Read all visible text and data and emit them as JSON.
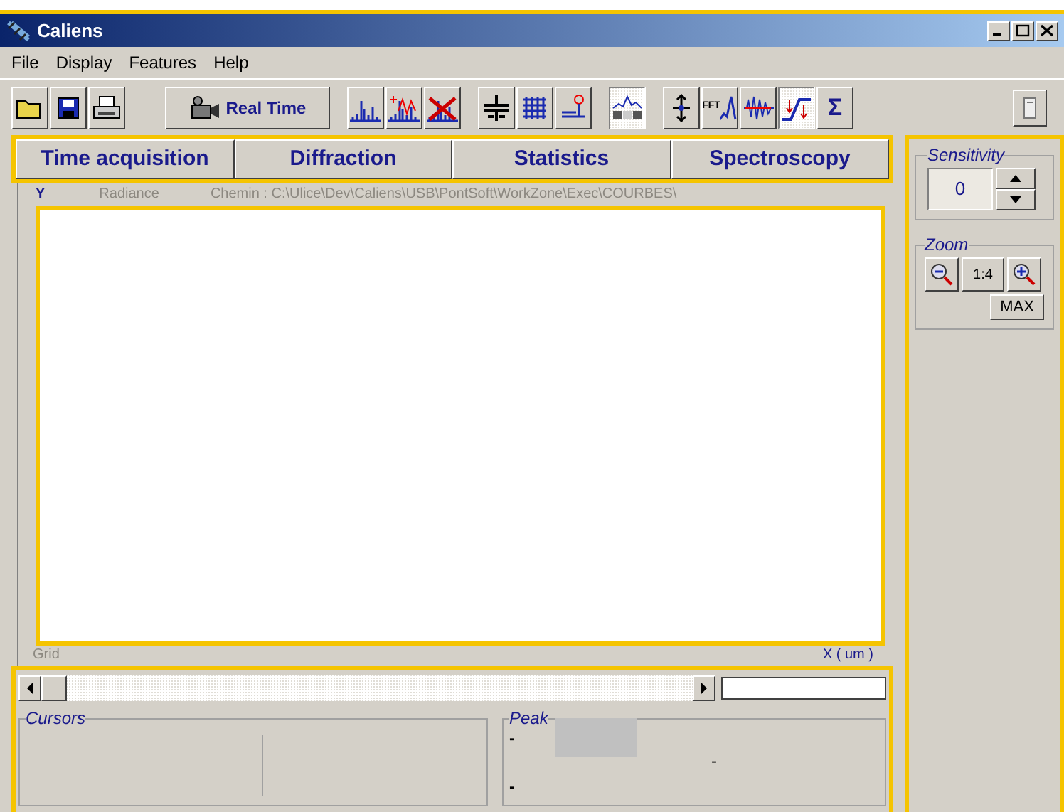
{
  "window": {
    "title": "Caliens"
  },
  "menu": [
    "File",
    "Display",
    "Features",
    "Help"
  ],
  "toolbar": [
    [
      {
        "kind": "open",
        "pressed": false
      },
      {
        "kind": "save",
        "pressed": false
      },
      {
        "kind": "print",
        "pressed": false
      }
    ],
    [
      {
        "kind": "realtime",
        "label": "Real Time",
        "pressed": false
      }
    ],
    [
      {
        "kind": "spectrum",
        "pressed": false
      },
      {
        "kind": "spectrum-add",
        "pressed": false
      },
      {
        "kind": "spectrum-delete",
        "pressed": false
      }
    ],
    [
      {
        "kind": "split",
        "pressed": false
      },
      {
        "kind": "grid",
        "pressed": false
      },
      {
        "kind": "marker",
        "pressed": false
      }
    ],
    [
      {
        "kind": "peak",
        "pressed": true
      }
    ],
    [
      {
        "kind": "axes",
        "pressed": false
      },
      {
        "kind": "fft",
        "label": "FFT",
        "pressed": false
      },
      {
        "kind": "filter",
        "pressed": false
      },
      {
        "kind": "step",
        "pressed": true
      },
      {
        "kind": "sigma",
        "label": "Σ",
        "pressed": false
      }
    ]
  ],
  "tabs": [
    {
      "label": "Time acquisition",
      "selected": false
    },
    {
      "label": "Diffraction",
      "selected": false
    },
    {
      "label": "Statistics",
      "selected": false
    },
    {
      "label": "Spectroscopy",
      "selected": false
    }
  ],
  "plot": {
    "y_axis": "Y",
    "quantity": "Radiance",
    "path": "Chemin :  C:\\Ulice\\Dev\\Caliens\\USB\\PontSoft\\WorkZone\\Exec\\COURBES\\",
    "grid": "Grid",
    "x_axis": "X ( um )"
  },
  "sensitivity": {
    "title": "Sensitivity",
    "value": "0"
  },
  "zoom": {
    "title": "Zoom",
    "ratio": "1:4",
    "max": "MAX"
  },
  "cursors": {
    "title": "Cursors"
  },
  "peak": {
    "title": "Peak",
    "marks": [
      "-",
      "-",
      "-"
    ]
  }
}
